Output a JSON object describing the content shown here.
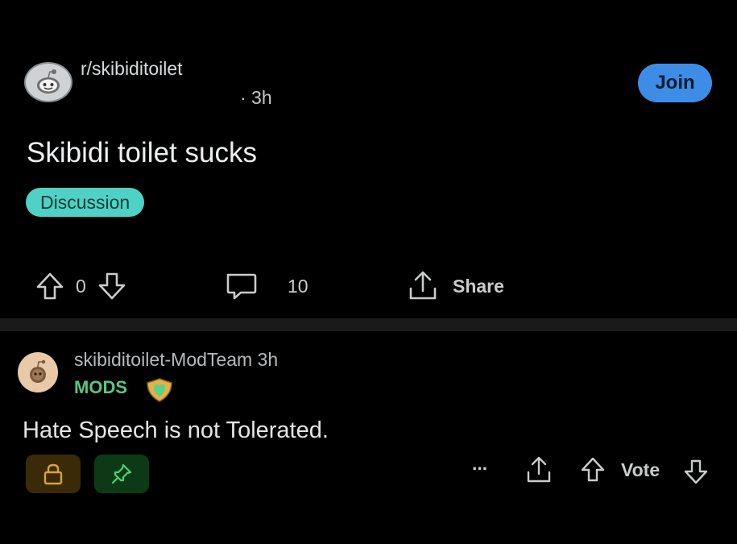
{
  "post": {
    "subreddit": "r/skibiditoilet",
    "time": "· 3h",
    "join_label": "Join",
    "title": "Skibidi toilet sucks",
    "flair": "Discussion",
    "score": "0",
    "comments": "10",
    "share_label": "Share"
  },
  "comment": {
    "author": "skibiditoilet-ModTeam 3h",
    "role": "MODS",
    "text": "Hate Speech is not Tolerated.",
    "more_label": "...",
    "vote_label": "Vote"
  },
  "colors": {
    "join_bg": "#3d8de6",
    "flair_bg": "#4fd1c5",
    "mods_green": "#58c783",
    "lock_bg": "#3a2a08",
    "pin_bg": "#0d3a16"
  }
}
